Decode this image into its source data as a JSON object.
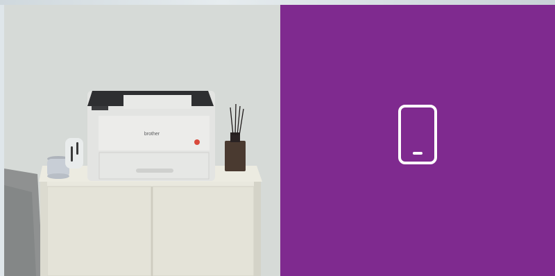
{
  "hero": {
    "image": {
      "printer_brand_label": "brother"
    },
    "right_panel": {
      "background_color": "#7f2a8f",
      "icon_name": "smartphone-icon"
    }
  }
}
